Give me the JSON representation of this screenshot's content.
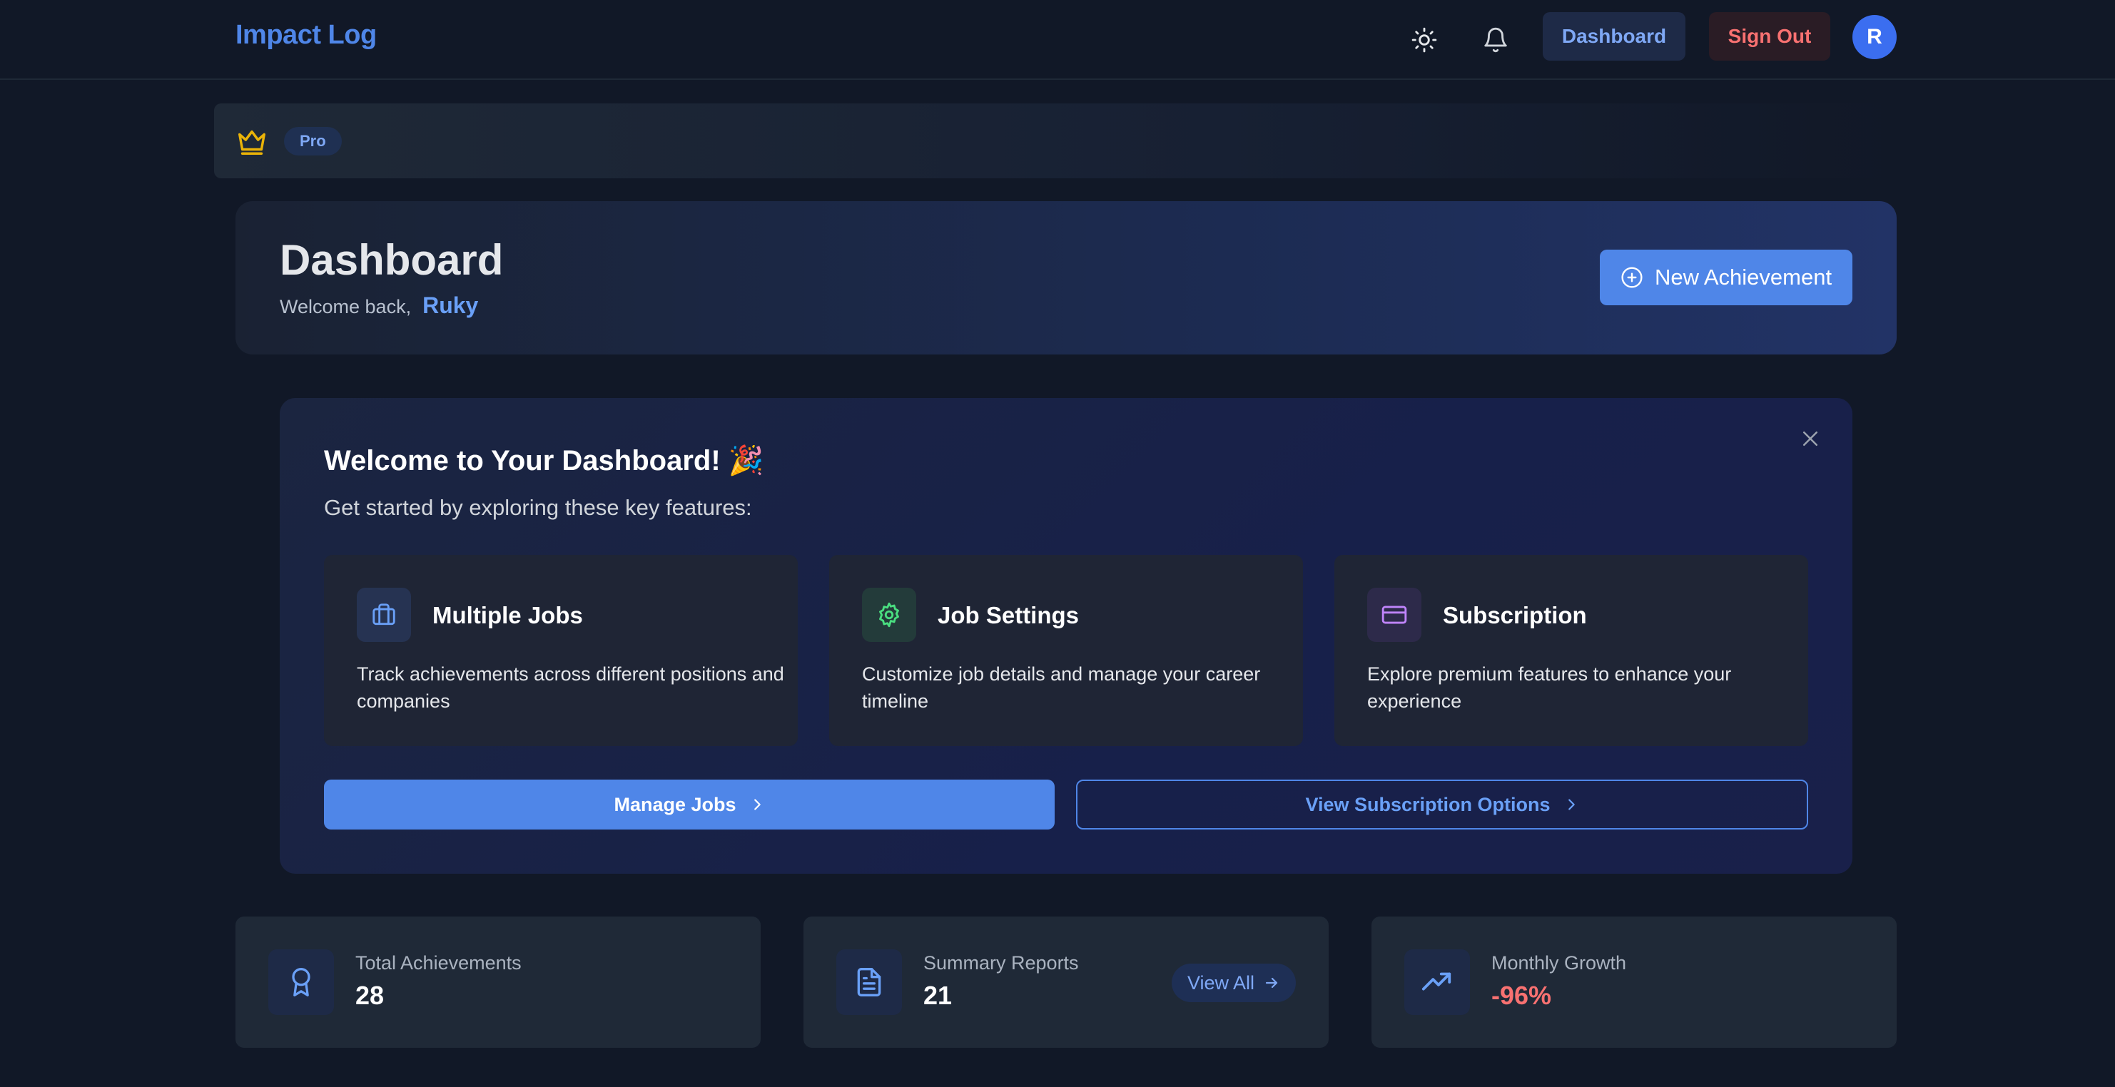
{
  "brand": "Impact Log",
  "nav": {
    "dashboard_label": "Dashboard",
    "signout_label": "Sign Out",
    "avatar_initial": "R"
  },
  "plan": {
    "badge": "Pro"
  },
  "header": {
    "title": "Dashboard",
    "welcome_prefix": "Welcome back,",
    "user_name": "Ruky",
    "new_button_label": "New Achievement"
  },
  "welcome_panel": {
    "title": "Welcome to Your Dashboard! 🎉",
    "subtitle": "Get started by exploring these key features:",
    "features": [
      {
        "title": "Multiple Jobs",
        "desc": "Track achievements across different positions and companies"
      },
      {
        "title": "Job Settings",
        "desc": "Customize job details and manage your career timeline"
      },
      {
        "title": "Subscription",
        "desc": "Explore premium features to enhance your experience"
      }
    ],
    "manage_jobs_label": "Manage Jobs",
    "subscription_label": "View Subscription Options"
  },
  "stats": [
    {
      "label": "Total Achievements",
      "value": "28"
    },
    {
      "label": "Summary Reports",
      "value": "21",
      "action": "View All"
    },
    {
      "label": "Monthly Growth",
      "value": "-96%"
    }
  ],
  "colors": {
    "accent": "#4f86e8",
    "danger": "#f87171",
    "crown": "#eab308",
    "settings_icon": "#4ade80",
    "subscription_icon": "#c084fc"
  }
}
